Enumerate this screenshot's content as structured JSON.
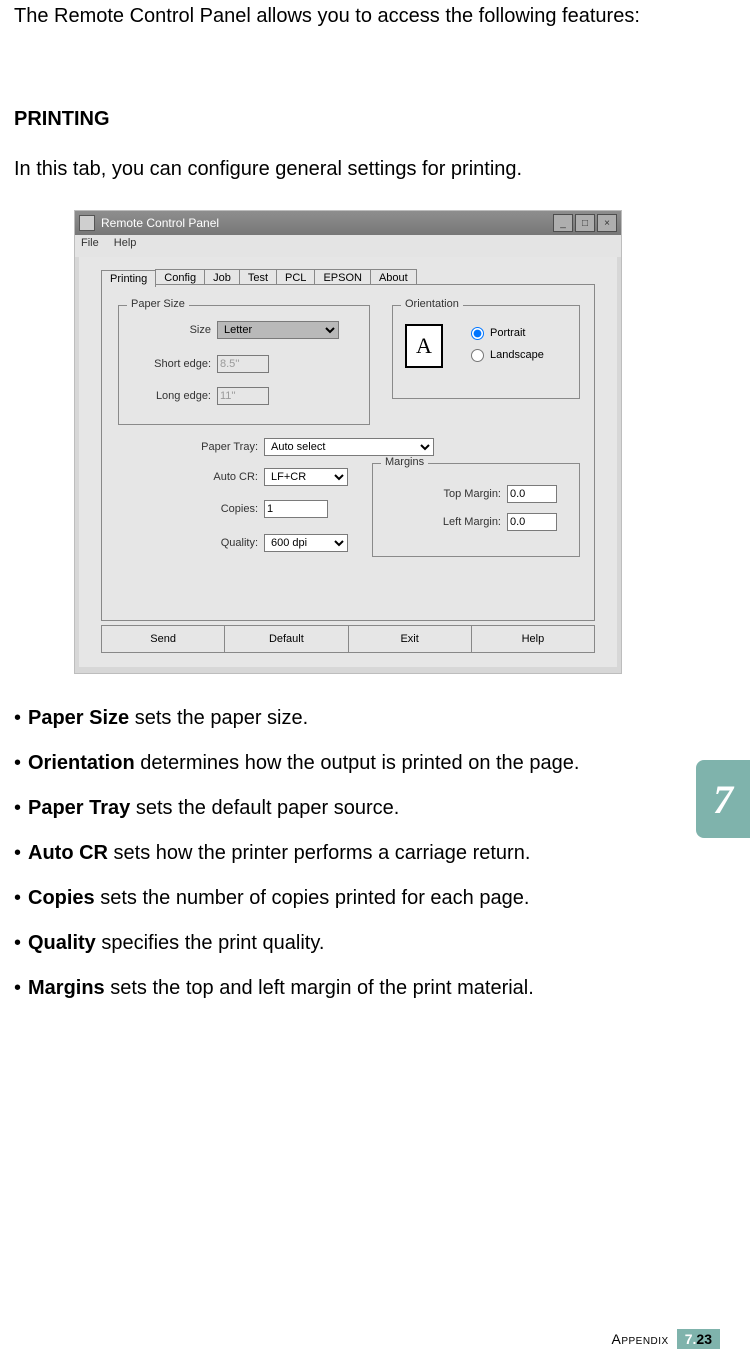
{
  "intro": "The Remote Control Panel allows you to access the following features:",
  "heading_printing": "PRINTING",
  "subintro": "In this tab, you can configure general settings for printing.",
  "window": {
    "title": "Remote Control Panel",
    "menu_file": "File",
    "menu_help": "Help",
    "tabs": {
      "printing": "Printing",
      "config": "Config",
      "job": "Job",
      "test": "Test",
      "pcl": "PCL",
      "epson": "EPSON",
      "about": "About"
    },
    "groups": {
      "paper_size": {
        "legend": "Paper Size",
        "size_label": "Size",
        "size_value": "Letter",
        "short_label": "Short edge:",
        "short_value": "8.5''",
        "long_label": "Long edge:",
        "long_value": "11''"
      },
      "orientation": {
        "legend": "Orientation",
        "portrait": "Portrait",
        "landscape": "Landscape",
        "icon_letter": "A"
      },
      "paper_tray": {
        "label": "Paper Tray:",
        "value": "Auto select"
      },
      "auto_cr": {
        "label": "Auto CR:",
        "value": "LF+CR"
      },
      "copies": {
        "label": "Copies:",
        "value": "1"
      },
      "quality": {
        "label": "Quality:",
        "value": "600 dpi"
      },
      "margins": {
        "legend": "Margins",
        "top_label": "Top Margin:",
        "top_value": "0.0",
        "left_label": "Left Margin:",
        "left_value": "0.0"
      }
    },
    "buttons": {
      "send": "Send",
      "default": "Default",
      "exit": "Exit",
      "help": "Help"
    }
  },
  "bullets": {
    "paper_size": {
      "b": "Paper Size",
      "t": " sets the paper size."
    },
    "orientation": {
      "b": "Orientation",
      "t": " determines how the output is printed on the page."
    },
    "paper_tray": {
      "b": "Paper Tray",
      "t": " sets the default paper source."
    },
    "auto_cr": {
      "b": "Auto CR",
      "t": " sets how the printer performs a carriage return."
    },
    "copies": {
      "b": "Copies",
      "t": " sets the number of copies printed for each page."
    },
    "quality": {
      "b": "Quality",
      "t": " specifies the print quality."
    },
    "margins": {
      "b": "Margins",
      "t": " sets the top and left margin of the print material."
    }
  },
  "chapter_tab": "7",
  "footer": {
    "appendix": "Appendix",
    "chapter": "7.",
    "page": "23"
  }
}
